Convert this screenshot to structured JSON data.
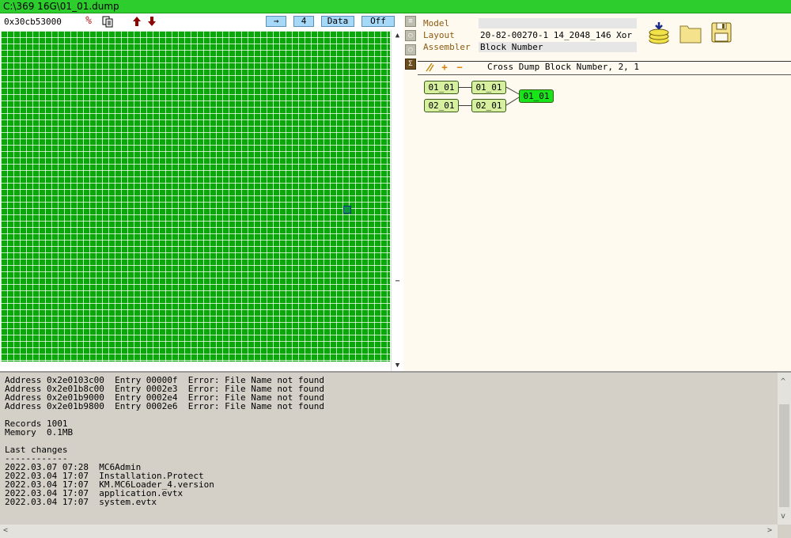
{
  "window": {
    "title": "C:\\369 16G\\01_01.dump"
  },
  "toolbar": {
    "address": "0x30cb53000",
    "arrow_button": "→",
    "count_button": "4",
    "mode_button": "Data",
    "toggle_button": "Off"
  },
  "properties": {
    "model_label": "Model",
    "model_value": "",
    "layout_label": "Layout",
    "layout_value": "20-82-00270-1 14_2048_146 Xor",
    "assembler_label": "Assembler",
    "assembler_value": "Block Number"
  },
  "cross": {
    "title": "Cross Dump Block Number, 2, 1",
    "nodes": {
      "a1": "01_01",
      "a2": "01_01",
      "b1": "02_01",
      "b2": "02_01",
      "result": "01_01"
    }
  },
  "log": {
    "lines": [
      "Address 0x2e0103c00  Entry 00000f  Error: File Name not found",
      "Address 0x2e01b8c00  Entry 0002e3  Error: File Name not found",
      "Address 0x2e01b9000  Entry 0002e4  Error: File Name not found",
      "Address 0x2e01b9800  Entry 0002e6  Error: File Name not found",
      "",
      "Records 1001",
      "Memory  0.1MB",
      "",
      "Last changes",
      "------------",
      "2022.03.07 07:28  MC6Admin",
      "2022.03.04 17:07  Installation.Protect",
      "2022.03.04 17:07  KM.MC6Loader_4.version",
      "2022.03.04 17:07  application.evtx",
      "2022.03.04 17:07  system.evtx"
    ]
  },
  "colors": {
    "titlebar": "#2ccd2c",
    "grid_cell": "#08a808",
    "node": "#d6f0a0",
    "node_result": "#19e419",
    "label": "#8a5a12",
    "button": "#a6d8f7"
  },
  "icons": {
    "toolbar": [
      "percent-icon",
      "copy-icon",
      "arrow-up-icon",
      "arrow-down-icon"
    ],
    "sidebar": [
      "list-icon",
      "bulb-icon",
      "bulb-icon",
      "cross-icon"
    ],
    "actions": [
      "database-load-icon",
      "folder-icon",
      "save-icon"
    ],
    "cross_tools": [
      "brush-icon",
      "plus-icon",
      "minus-icon"
    ]
  }
}
